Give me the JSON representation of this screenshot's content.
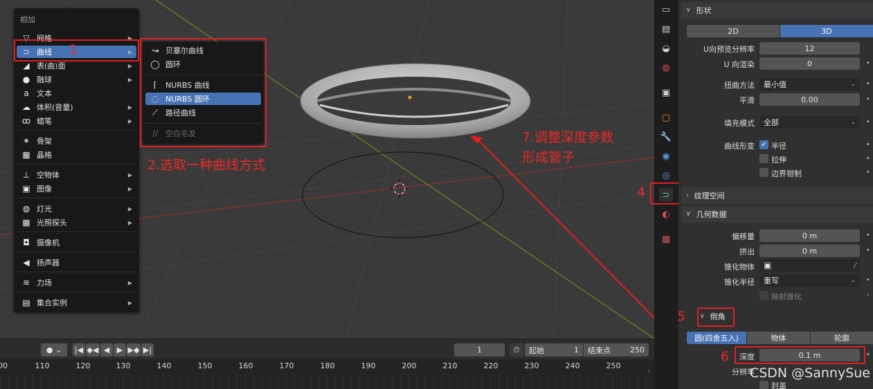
{
  "add_menu": {
    "title": "相加",
    "items": [
      {
        "label": "网格",
        "icon": "mesh-icon",
        "glyph": "▽",
        "sub": true
      },
      {
        "label": "曲线",
        "icon": "curve-icon",
        "glyph": "⊃",
        "sub": true,
        "active": true
      },
      {
        "label": "表(曲)面",
        "icon": "surface-icon",
        "glyph": "◢",
        "sub": true
      },
      {
        "label": "融球",
        "icon": "metaball-icon",
        "glyph": "●",
        "sub": true
      },
      {
        "label": "文本",
        "icon": "text-icon",
        "glyph": "a",
        "sub": false
      },
      {
        "label": "体积(音量)",
        "icon": "volume-icon",
        "glyph": "☁",
        "sub": true
      },
      {
        "label": "蜡笔",
        "icon": "grease-pencil-icon",
        "glyph": "ꝏ",
        "sub": true
      },
      {
        "label": "骨架",
        "icon": "armature-icon",
        "glyph": "✶",
        "sub": false
      },
      {
        "label": "晶格",
        "icon": "lattice-icon",
        "glyph": "▦",
        "sub": false
      },
      {
        "label": "空物体",
        "icon": "empty-icon",
        "glyph": "⊥",
        "sub": true
      },
      {
        "label": "图像",
        "icon": "image-icon",
        "glyph": "▣",
        "sub": true
      },
      {
        "label": "灯光",
        "icon": "light-icon",
        "glyph": "◍",
        "sub": true
      },
      {
        "label": "光照探头",
        "icon": "light-probe-icon",
        "glyph": "▩",
        "sub": true
      },
      {
        "label": "摄像机",
        "icon": "camera-icon",
        "glyph": "◘",
        "sub": false
      },
      {
        "label": "扬声器",
        "icon": "speaker-icon",
        "glyph": "◀",
        "sub": false
      },
      {
        "label": "力场",
        "icon": "force-field-icon",
        "glyph": "≋",
        "sub": true
      },
      {
        "label": "集合实例",
        "icon": "collection-icon",
        "glyph": "▤",
        "sub": true
      }
    ]
  },
  "curve_menu": {
    "items": [
      {
        "label": "贝塞尔曲线",
        "icon": "bezier-curve-icon",
        "glyph": "↝"
      },
      {
        "label": "圆环",
        "icon": "bezier-circle-icon",
        "glyph": "◯"
      },
      {
        "label": "NURBS 曲线",
        "icon": "nurbs-curve-icon",
        "glyph": "⌈"
      },
      {
        "label": "NURBS 圆环",
        "icon": "nurbs-circle-icon",
        "glyph": "◌",
        "active": true
      },
      {
        "label": "路径曲线",
        "icon": "path-curve-icon",
        "glyph": "⟋"
      },
      {
        "label": "空白毛发",
        "icon": "hair-icon",
        "glyph": "//",
        "disabled": true
      }
    ]
  },
  "annotations": {
    "a1": "1",
    "a2": "2.选取一种曲线方式",
    "a4": "4",
    "a5": "5",
    "a6": "6",
    "a7_line1": "7.调整深度参数",
    "a7_line2": "形成管子",
    "color": "#e02020"
  },
  "timeline": {
    "current_frame": "1",
    "start_label": "起始",
    "start_value": "1",
    "end_label": "结束点",
    "end_value": "250",
    "ticks": [
      "00",
      "110",
      "120",
      "130",
      "140",
      "150",
      "160",
      "170",
      "180",
      "190",
      "200",
      "210",
      "220",
      "230",
      "240",
      "250"
    ]
  },
  "properties": {
    "shape_panel": {
      "title": "形状",
      "mode_2d": "2D",
      "mode_3d": "3D",
      "resolution_preview_u_label": "U向预览分辨率",
      "resolution_preview_u": "12",
      "render_u_label": "U 向渲染",
      "render_u": "0",
      "twist_method_label": "扭曲方法",
      "twist_method": "最小值",
      "smooth_label": "平滑",
      "smooth": "0.00",
      "fill_mode_label": "填充模式",
      "fill_mode": "全部",
      "curve_deform_label": "曲线形变",
      "radius_label": "半径",
      "stretch_label": "拉伸",
      "bounds_clamp_label": "边界钳制"
    },
    "texture_space": {
      "title": "纹理空间"
    },
    "geometry": {
      "title": "几何数据",
      "offset_label": "偏移量",
      "offset": "0 m",
      "extrude_label": "挤出",
      "extrude": "0 m",
      "taper_object_label": "锥化物体",
      "taper_radius_label": "锥化半径",
      "taper_radius": "重写",
      "map_taper_label": "映射锥化"
    },
    "bevel": {
      "title": "倒角",
      "mode_round": "圆(四舍五入)",
      "mode_object": "物体",
      "mode_profile": "轮廓",
      "depth_label": "深度",
      "depth": "0.1 m",
      "resolution_label": "分辨率",
      "fill_caps_label": "封盖"
    }
  },
  "watermark": "CSDN @SannySue"
}
